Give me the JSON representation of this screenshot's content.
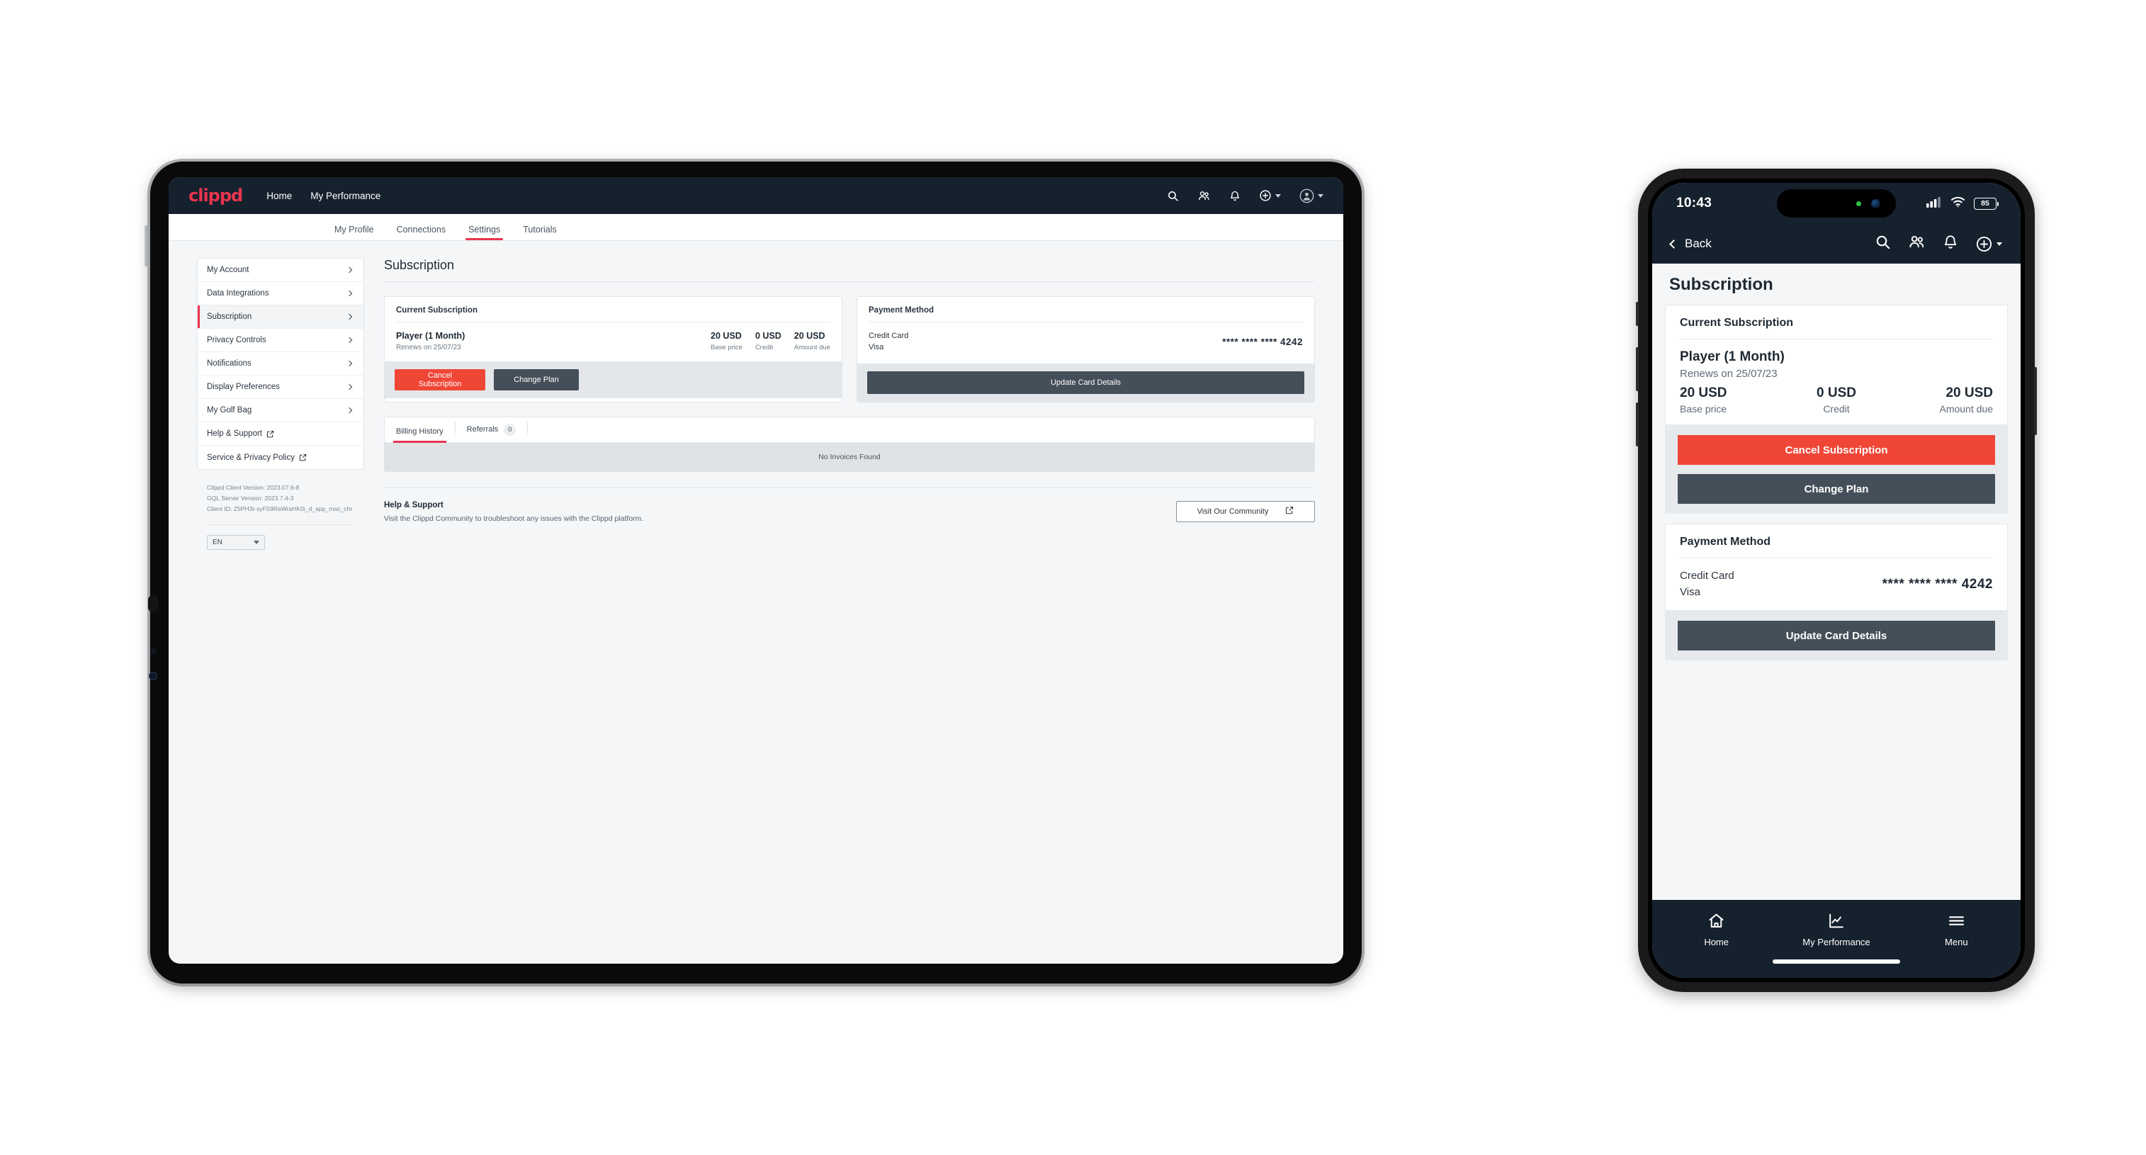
{
  "tablet": {
    "topbar": {
      "logo": "clippd",
      "nav": [
        {
          "label": "Home"
        },
        {
          "label": "My Performance"
        }
      ],
      "icons": [
        "search-icon",
        "people-icon",
        "bell-icon",
        "plus-circle-icon",
        "avatar-icon"
      ]
    },
    "tabs": [
      {
        "label": "My Profile",
        "active": false
      },
      {
        "label": "Connections",
        "active": false
      },
      {
        "label": "Settings",
        "active": true
      },
      {
        "label": "Tutorials",
        "active": false
      }
    ],
    "sidebar": {
      "items": [
        {
          "label": "My Account",
          "type": "chevron",
          "selected": false
        },
        {
          "label": "Data Integrations",
          "type": "chevron",
          "selected": false
        },
        {
          "label": "Subscription",
          "type": "chevron",
          "selected": true
        },
        {
          "label": "Privacy Controls",
          "type": "chevron",
          "selected": false
        },
        {
          "label": "Notifications",
          "type": "chevron",
          "selected": false
        },
        {
          "label": "Display Preferences",
          "type": "chevron",
          "selected": false
        },
        {
          "label": "My Golf Bag",
          "type": "chevron",
          "selected": false
        },
        {
          "label": "Help & Support",
          "type": "external",
          "selected": false
        },
        {
          "label": "Service & Privacy Policy",
          "type": "external",
          "selected": false
        }
      ],
      "versions": {
        "client": "Clippd Client Version: 2023.07.6-8",
        "server": "GQL Server Version: 2023.7.4-3",
        "client_id": "Client ID: Z5PH3r-syF59RaWraHK0i_d_app_mac_chr"
      },
      "language": "EN"
    },
    "main": {
      "page_title": "Subscription",
      "current_subscription": {
        "header": "Current Subscription",
        "plan_name": "Player (1 Month)",
        "renews": "Renews on 25/07/23",
        "base_price_value": "20 USD",
        "base_price_label": "Base price",
        "credit_value": "0 USD",
        "credit_label": "Credit",
        "amount_due_value": "20 USD",
        "amount_due_label": "Amount due",
        "cancel_label": "Cancel Subscription",
        "change_label": "Change Plan"
      },
      "payment_method": {
        "header": "Payment Method",
        "type": "Credit Card",
        "brand": "Visa",
        "number": "**** **** **** 4242",
        "update_label": "Update Card Details"
      },
      "billing": {
        "tab_billing": "Billing History",
        "tab_referrals": "Referrals",
        "referrals_count": "0",
        "empty": "No Invoices Found"
      },
      "help": {
        "title": "Help & Support",
        "description": "Visit the Clippd Community to troubleshoot any issues with the Clippd platform.",
        "button": "Visit Our Community"
      }
    }
  },
  "phone": {
    "status": {
      "time": "10:43",
      "battery": "85"
    },
    "header": {
      "back": "Back",
      "icons": [
        "search-icon",
        "people-icon",
        "bell-icon",
        "plus-circle-icon"
      ]
    },
    "page_title": "Subscription",
    "current_subscription": {
      "header": "Current Subscription",
      "plan_name": "Player (1 Month)",
      "renews": "Renews on 25/07/23",
      "base_price_value": "20 USD",
      "base_price_label": "Base price",
      "credit_value": "0 USD",
      "credit_label": "Credit",
      "amount_due_value": "20 USD",
      "amount_due_label": "Amount due",
      "cancel_label": "Cancel Subscription",
      "change_label": "Change Plan"
    },
    "payment_method": {
      "header": "Payment Method",
      "type": "Credit Card",
      "brand": "Visa",
      "number": "**** **** **** 4242",
      "update_label": "Update Card Details"
    },
    "bottom_nav": [
      {
        "label": "Home",
        "icon": "home-icon"
      },
      {
        "label": "My Performance",
        "icon": "chart-icon"
      },
      {
        "label": "Menu",
        "icon": "hamburger-icon"
      }
    ]
  },
  "colors": {
    "navy": "#16212e",
    "accent_red": "#e8344e",
    "danger": "#ef4636",
    "dark_button": "#454f59"
  }
}
